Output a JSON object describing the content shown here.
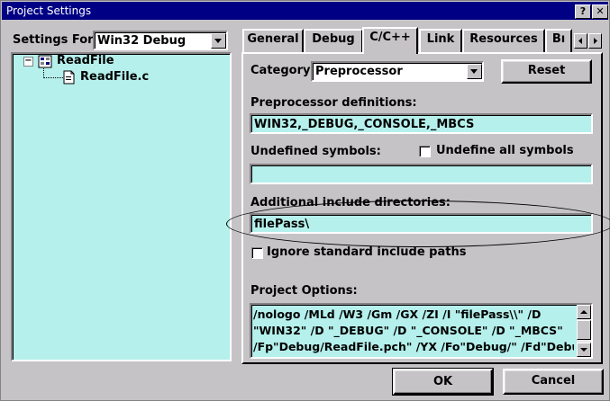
{
  "window": {
    "title": "Project Settings",
    "help_btn": "?",
    "close_btn": "✕"
  },
  "left": {
    "settings_for_label": "Settings For:",
    "settings_for_value": "Win32 Debug",
    "tree": {
      "root": "ReadFile",
      "root_toggle": "−",
      "child": "ReadFile.c"
    }
  },
  "tabs": [
    {
      "label": "General"
    },
    {
      "label": "Debug"
    },
    {
      "label": "C/C++"
    },
    {
      "label": "Link"
    },
    {
      "label": "Resources"
    },
    {
      "label": "Bı"
    }
  ],
  "active_tab": "C/C++",
  "panel": {
    "category_label": "Category:",
    "category_value": "Preprocessor",
    "reset_label": "Reset",
    "preproc_label": "Preprocessor definitions:",
    "preproc_value": "WIN32,_DEBUG,_CONSOLE,_MBCS",
    "undef_label": "Undefined symbols:",
    "undef_value": "",
    "undef_all_label": "Undefine all symbols",
    "undef_all_checked": false,
    "incdirs_label": "Additional include directories:",
    "incdirs_value": "filePass\\",
    "ignore_std_label": "Ignore standard include paths",
    "ignore_std_checked": false,
    "options_label": "Project Options:",
    "options_lines": [
      "/nologo /MLd /W3 /Gm /GX /ZI /I \"filePass\\\\\" /D",
      "\"WIN32\" /D \"_DEBUG\" /D \"_CONSOLE\" /D \"_MBCS\"",
      "/Fp\"Debug/ReadFile.pch\" /YX /Fo\"Debug/\" /Fd\"Debug/\""
    ]
  },
  "buttons": {
    "ok": "OK",
    "cancel": "Cancel"
  },
  "colors": {
    "titlebar": "#000084",
    "field_bg": "#b5f0ec",
    "face": "#c6c3c6"
  }
}
